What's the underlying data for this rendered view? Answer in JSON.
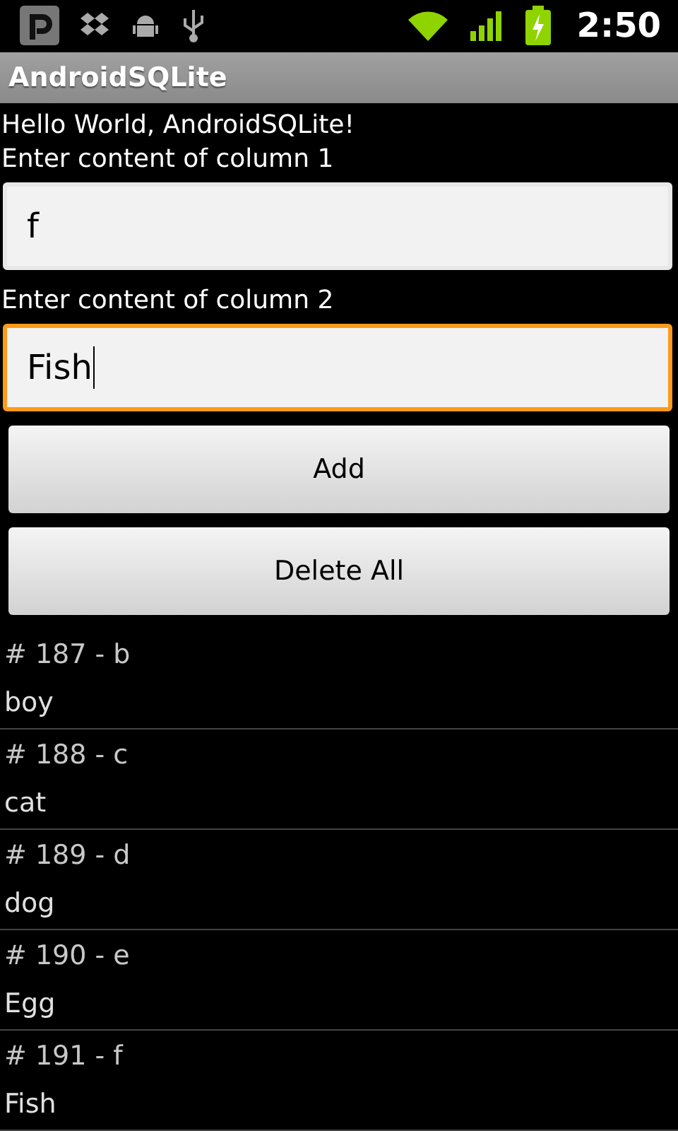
{
  "status_bar": {
    "time": "2:50"
  },
  "title_bar": {
    "title": "AndroidSQLite"
  },
  "greeting": "Hello World, AndroidSQLite!",
  "fields": [
    {
      "label": "Enter content of column 1",
      "value": "f",
      "focused": false
    },
    {
      "label": "Enter content of column 2",
      "value": "Fish",
      "focused": true
    }
  ],
  "buttons": [
    "Add",
    "Delete All"
  ],
  "records": [
    {
      "title": "# 187 - b",
      "subtitle": "boy"
    },
    {
      "title": "# 188 - c",
      "subtitle": "cat"
    },
    {
      "title": "# 189 - d",
      "subtitle": "dog"
    },
    {
      "title": "# 190 - e",
      "subtitle": "Egg"
    },
    {
      "title": "# 191 - f",
      "subtitle": "Fish"
    }
  ]
}
